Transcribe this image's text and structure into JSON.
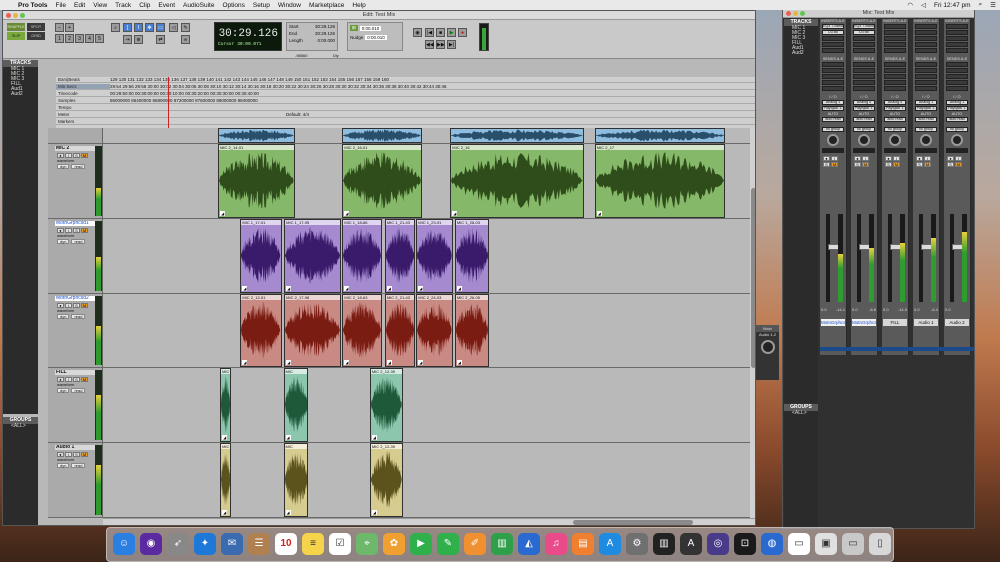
{
  "menubar": {
    "app": "Pro Tools",
    "items": [
      "File",
      "Edit",
      "View",
      "Track",
      "Clip",
      "Event",
      "AudioSuite",
      "Options",
      "Setup",
      "Window",
      "Marketplace",
      "Help"
    ],
    "clock": "Fri 12:47 pm"
  },
  "edit_window": {
    "title": "Edit: Test Mix",
    "counter": "30:29.126",
    "cursor_label": "Cursor",
    "cursor_value": "30:00.071",
    "start_label": "Start",
    "start_value": "30:29.126",
    "end_label": "End",
    "end_value": "30:29.126",
    "length_label": "Length",
    "length_value": "0:00.000",
    "grid_value": "0:00.010",
    "nudge_label": "Nudge",
    "nudge_value": "0:00.010",
    "shuffle": "SHUFFLE",
    "spot": "SPOT",
    "slip": "SLIP",
    "grid": "GRID",
    "zoom_readout": "-98560",
    "dly": "Dly",
    "tracks_panel_title": "TRACKS",
    "tracks_list": [
      "MIC 1",
      "MIC 2",
      "MIC 3",
      "FILL",
      "Aud1",
      "Aud2"
    ],
    "groups_panel_title": "GROUPS",
    "groups_list": [
      "<ALL>"
    ],
    "rulers": [
      {
        "label": "Bars|Beats",
        "ticks": "129  130  131  132  133  134  135  136  137  138  139  140  141  142  143  144  145  146  147  148  149  150  151  152  153  154  155  156  157  158  159  160"
      },
      {
        "label": "Min:Secs",
        "ticks": "29:54   29:56   29:58   30:00   30:02   30:04   30:06   30:08   30:10   30:12   30:14   30:16   30:18   30:20   30:22   30:24   30:26   30:28   30:30   30:32   30:34   30:36   30:38   30:40   30:42   30:44   30:46"
      },
      {
        "label": "Timecode",
        "ticks": "00:29:50:00          00:30:00:00          00:30:10:00          00:30:20:00          00:30:30:00          00:30:40:00"
      },
      {
        "label": "Samples",
        "ticks": "86000000     86400000     86800000     87200000     87600000     88000000     88400000"
      },
      {
        "label": "Tempo",
        "ticks": ""
      },
      {
        "label": "Meter",
        "ticks": "Default: 4/4"
      },
      {
        "label": "Markers",
        "ticks": ""
      }
    ],
    "tracks": [
      {
        "name": "MIC 2",
        "view": "waveform",
        "dyn": "dyn",
        "read": "read",
        "color": "#86b86a",
        "wave": "#2f4d1a",
        "clips": [
          {
            "name": "MIC 2_14-01",
            "pos": 0.176,
            "w": 0.117
          },
          {
            "name": "MIC 2_16-01",
            "pos": 0.366,
            "w": 0.122
          },
          {
            "name": "MIC 2_16",
            "pos": 0.531,
            "w": 0.204
          },
          {
            "name": "MIC 2_17",
            "pos": 0.752,
            "w": 0.199
          }
        ]
      },
      {
        "name": "MotnGrphcsd1",
        "view": "waveform",
        "dyn": "dyn",
        "read": "read",
        "color": "#a58ad0",
        "wave": "#3a1a6a",
        "clips": [
          {
            "name": "MIC 1_17-01",
            "pos": 0.21,
            "w": 0.063
          },
          {
            "name": "MIC 1_17-95",
            "pos": 0.277,
            "w": 0.087
          },
          {
            "name": "MIC 1_18-86",
            "pos": 0.366,
            "w": 0.061
          },
          {
            "name": "MIC 1_21-43",
            "pos": 0.431,
            "w": 0.046
          },
          {
            "name": "MIC 1_23-91",
            "pos": 0.479,
            "w": 0.056
          },
          {
            "name": "MIC 1_26-03",
            "pos": 0.538,
            "w": 0.052
          }
        ]
      },
      {
        "name": "MotnGrphcsd2",
        "view": "waveform",
        "dyn": "dyn",
        "read": "read",
        "color": "#c98a84",
        "wave": "#7a1c12",
        "clips": [
          {
            "name": "MIC 2_12-51",
            "pos": 0.21,
            "w": 0.063
          },
          {
            "name": "MIC 2_17-98",
            "pos": 0.277,
            "w": 0.087
          },
          {
            "name": "MIC 2_18-63",
            "pos": 0.366,
            "w": 0.061
          },
          {
            "name": "MIC 2_21-43",
            "pos": 0.431,
            "w": 0.046
          },
          {
            "name": "MIC 2_24-03",
            "pos": 0.479,
            "w": 0.056
          },
          {
            "name": "MIC 2_26-05",
            "pos": 0.538,
            "w": 0.052
          }
        ]
      },
      {
        "name": "FILL",
        "view": "waveform",
        "dyn": "dyn",
        "read": "read",
        "color": "#8cc6ac",
        "wave": "#1e5a3a",
        "clips": [
          {
            "name": "MIC",
            "pos": 0.179,
            "w": 0.017
          },
          {
            "name": "MIC",
            "pos": 0.276,
            "w": 0.038
          },
          {
            "name": "MIC 2_12-39",
            "pos": 0.408,
            "w": 0.05
          }
        ]
      },
      {
        "name": "Audio 1",
        "view": "waveform",
        "dyn": "dyn",
        "read": "read",
        "color": "#d6cc90",
        "wave": "#5c521c",
        "clips": [
          {
            "name": "MIC",
            "pos": 0.179,
            "w": 0.017
          },
          {
            "name": "MIC",
            "pos": 0.276,
            "w": 0.038
          },
          {
            "name": "MIC 2_12-39",
            "pos": 0.408,
            "w": 0.05
          }
        ]
      }
    ]
  },
  "mix_window": {
    "title": "Mix: Test Mix",
    "inserts_label": "INSERTS A-E",
    "sends_label": "SENDS A-E",
    "io_label": "I / O",
    "auto_label": "AUTO",
    "no_group": "no group",
    "main_label": "Main",
    "main_sub": "Audio 1-2",
    "strips": [
      {
        "name": "MotnGrphcs1",
        "insert": "EQ3 7-Band",
        "insert2": "D3 Bk",
        "input": "Analog 1",
        "output": "Playback 1-2",
        "auto": "auto read",
        "vol": "0.0",
        "pan": "-14.1",
        "sel": true
      },
      {
        "name": "MotnGrphcs2",
        "insert": "EQ3 7-Band",
        "insert2": "D3 Bk",
        "input": "Analog 4",
        "output": "Playback 1-2",
        "auto": "auto read",
        "vol": "0.0",
        "pan": "-8.6",
        "sel": true
      },
      {
        "name": "FILL",
        "insert": "",
        "insert2": "",
        "input": "Analog 4",
        "output": "Playback 1-2",
        "auto": "auto read",
        "vol": "0.0",
        "pan": "-14.5",
        "sel": false
      },
      {
        "name": "Audio 1",
        "insert": "",
        "insert2": "",
        "input": "Analog 1",
        "output": "Playback 1-2",
        "auto": "auto read",
        "vol": "0.0",
        "pan": "-6.4",
        "sel": false
      },
      {
        "name": "Audio 2",
        "insert": "",
        "insert2": "",
        "input": "Analog 1",
        "output": "Playback 1-2",
        "auto": "auto read",
        "vol": "0.0",
        "pan": "",
        "sel": false
      }
    ],
    "tracks_panel_title": "TRACKS",
    "tracks_list": [
      "MIC 1",
      "MIC 2",
      "MIC 3",
      "FILL",
      "Aud1",
      "Aud2"
    ],
    "groups_panel_title": "GROUPS",
    "groups_list": [
      "<ALL>"
    ]
  },
  "dock": {
    "calendar_day": "10",
    "icons": [
      {
        "name": "finder-icon",
        "color": "#2a7fe0"
      },
      {
        "name": "siri-icon",
        "color": "#5b2aa0"
      },
      {
        "name": "launchpad-icon",
        "color": "#888888"
      },
      {
        "name": "safari-icon",
        "color": "#1e78d8"
      },
      {
        "name": "mail-stamp-icon",
        "color": "#3a6ab0"
      },
      {
        "name": "contacts-icon",
        "color": "#b08050"
      },
      {
        "name": "calendar-icon",
        "color": "#ffffff"
      },
      {
        "name": "notes-icon",
        "color": "#f5d34a"
      },
      {
        "name": "reminders-icon",
        "color": "#ffffff"
      },
      {
        "name": "maps-icon",
        "color": "#6db86a"
      },
      {
        "name": "photos-icon",
        "color": "#f0a030"
      },
      {
        "name": "facetime-icon",
        "color": "#2fb04a"
      },
      {
        "name": "messages-icon",
        "color": "#2fb04a"
      },
      {
        "name": "pages-icon",
        "color": "#f09030"
      },
      {
        "name": "numbers-icon",
        "color": "#2fa04a"
      },
      {
        "name": "keynote-icon",
        "color": "#2a6ad0"
      },
      {
        "name": "itunes-icon",
        "color": "#e84a8a"
      },
      {
        "name": "ibooks-icon",
        "color": "#f08030"
      },
      {
        "name": "appstore-icon",
        "color": "#1e8ae0"
      },
      {
        "name": "system-preferences-icon",
        "color": "#707070"
      },
      {
        "name": "piano-icon",
        "color": "#222222"
      },
      {
        "name": "apogee-icon",
        "color": "#333333"
      },
      {
        "name": "pro-tools-icon",
        "color": "#4a3a8a"
      },
      {
        "name": "ilok-icon",
        "color": "#1a1a1a"
      },
      {
        "name": "network-icon",
        "color": "#2a6ad0"
      },
      {
        "name": "document-icon",
        "color": "#ffffff"
      },
      {
        "name": "preview-icon",
        "color": "#e0e0e0"
      },
      {
        "name": "scanner-icon",
        "color": "#c8c8c8"
      },
      {
        "name": "trash-icon",
        "color": "#d8d8d8"
      }
    ]
  }
}
